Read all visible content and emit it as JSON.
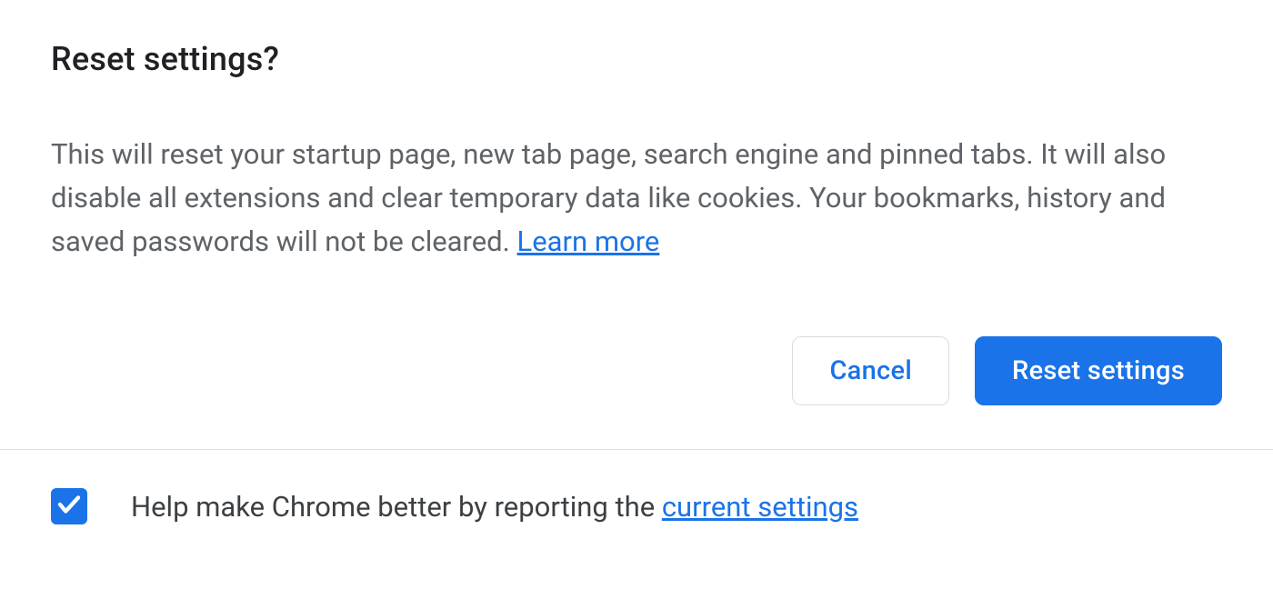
{
  "dialog": {
    "title": "Reset settings?",
    "body_text": "This will reset your startup page, new tab page, search engine and pinned tabs. It will also disable all extensions and clear temporary data like cookies. Your bookmarks, history and saved passwords will not be cleared. ",
    "learn_more": "Learn more",
    "cancel_label": "Cancel",
    "confirm_label": "Reset settings"
  },
  "footer": {
    "checkbox_checked": true,
    "text_before_link": "Help make Chrome better by reporting the ",
    "link_text": "current settings"
  }
}
